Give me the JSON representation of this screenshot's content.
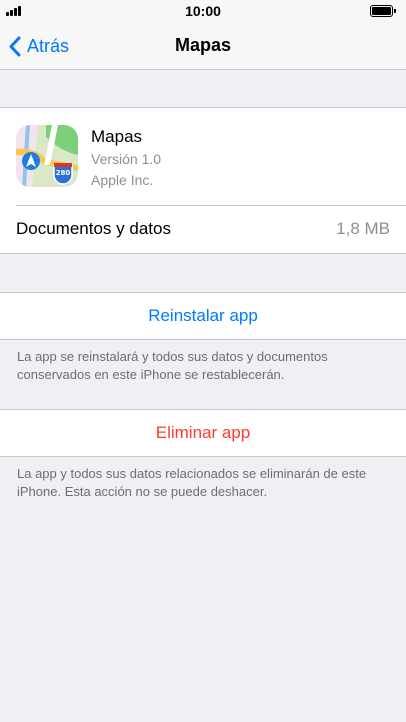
{
  "status_bar": {
    "time": "10:00",
    "icons": [
      "signal-icon",
      "battery-icon"
    ]
  },
  "nav": {
    "back_label": "Atrás",
    "title": "Mapas"
  },
  "app": {
    "name": "Mapas",
    "version": "Versión 1.0",
    "developer": "Apple Inc.",
    "icon": "maps-app-icon",
    "icon_badge": "280"
  },
  "storage": {
    "label": "Documentos y datos",
    "value": "1,8 MB"
  },
  "actions": {
    "reinstall_label": "Reinstalar app",
    "reinstall_note": "La app se reinstalará y todos sus datos y documentos conservados en este iPhone se restablecerán.",
    "delete_label": "Eliminar app",
    "delete_note": "La app y todos sus datos relacionados se eliminarán de este iPhone. Esta acción no se puede deshacer."
  },
  "colors": {
    "accent": "#007aff",
    "destructive": "#ff3b30",
    "background": "#efeff4",
    "secondary_text": "#8e8e93"
  }
}
